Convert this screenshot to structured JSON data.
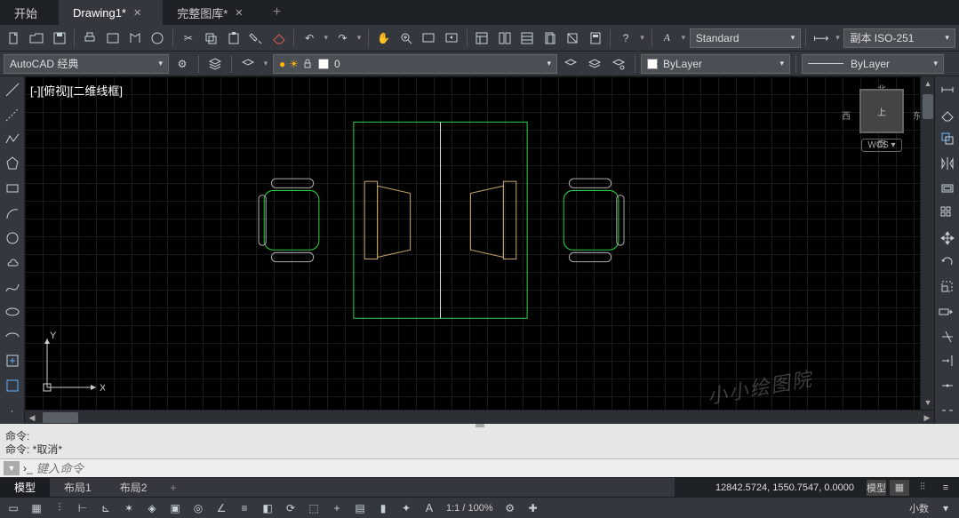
{
  "tabs": {
    "start": "开始",
    "drawing1": "Drawing1*",
    "library": "完整图库*"
  },
  "workspace": {
    "selected": "AutoCAD 经典"
  },
  "style": {
    "text_style": "Standard",
    "dim_style": "副本 ISO-251"
  },
  "layer": {
    "current": "0",
    "linetype": "ByLayer",
    "linetype2": "ByLayer"
  },
  "viewport": {
    "label": "[-][俯视][二维线框]"
  },
  "nav": {
    "north": "北",
    "south": "南",
    "east": "东",
    "west": "西",
    "top": "上",
    "wcs": "WCS"
  },
  "watermark": "小小绘图院",
  "ucs": {
    "x": "X",
    "y": "Y"
  },
  "command": {
    "hist1": "命令:",
    "hist2": "命令:  *取消*",
    "prompt_placeholder": "键入命令",
    "handle": "▼"
  },
  "layout_tabs": {
    "model": "模型",
    "layout1": "布局1",
    "layout2": "布局2"
  },
  "status": {
    "coords": "12842.5724, 1550.7547, 0.0000",
    "model_btn": "模型",
    "scale": "1:1 / 100%",
    "decimal": "小数"
  }
}
